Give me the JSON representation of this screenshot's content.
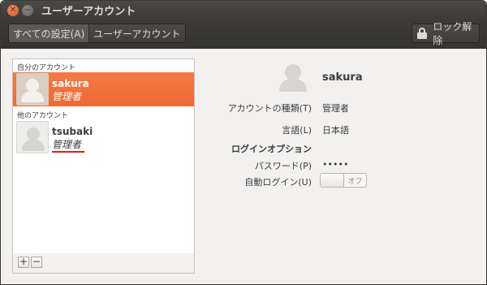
{
  "window": {
    "title": "ユーザーアカウント"
  },
  "toolbar": {
    "breadcrumbs": [
      {
        "label": "すべての設定(A)"
      },
      {
        "label": "ユーザーアカウント"
      }
    ],
    "unlock_label": "ロック解除"
  },
  "account_list": {
    "my_section_label": "自分のアカウント",
    "other_section_label": "他のアカウント",
    "accounts": [
      {
        "name": "sakura",
        "role": "管理者",
        "selected": true
      },
      {
        "name": "tsubaki",
        "role": "管理者",
        "selected": false
      }
    ],
    "add_label": "+",
    "remove_label": "−"
  },
  "detail": {
    "user_name": "sakura",
    "account_type_label": "アカウントの種類(T)",
    "account_type_value": "管理者",
    "language_label": "言語(L)",
    "language_value": "日本語",
    "login_options_heading": "ログインオプション",
    "password_label": "パスワード(P)",
    "password_value": "•••••",
    "autologin_label": "自動ログイン(U)",
    "autologin_state": "オフ"
  },
  "colors": {
    "selection": "#ee6d36",
    "titlebar": "#3c3b37",
    "annotation_underline": "#e0201c"
  },
  "icons": [
    "close-icon",
    "minimize-icon",
    "lock-icon",
    "user-avatar-icon"
  ]
}
